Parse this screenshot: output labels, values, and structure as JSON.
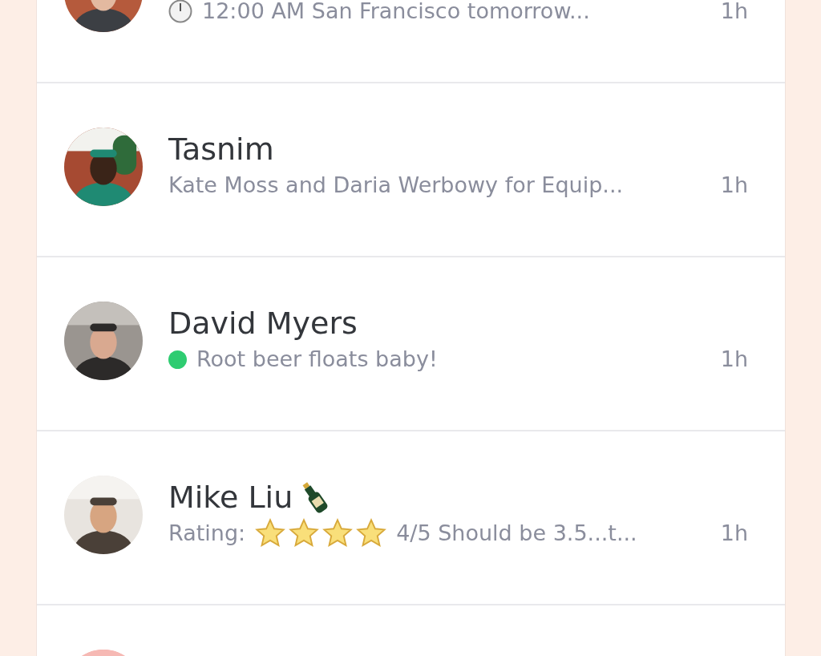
{
  "conversations": [
    {
      "message": "12:00 AM San Francisco tomorrow...",
      "time": "1h",
      "avatar": {
        "kind": "picture"
      }
    },
    {
      "name": "Tasnim",
      "message": "Kate Moss and Daria Werbowy for Equip...",
      "time": "1h",
      "avatar": {
        "kind": "picture"
      }
    },
    {
      "name": "David Myers",
      "status_dot": {
        "color": "#2ecc71"
      },
      "message": "Root beer floats baby!",
      "time": "1h",
      "avatar": {
        "kind": "picture"
      }
    },
    {
      "name": "Mike Liu",
      "message": "Rating:",
      "stars": 4,
      "message_after": "4/5 Should be 3.5...t...",
      "time": "1h",
      "avatar": {
        "kind": "picture"
      }
    },
    {
      "avatar": {
        "kind": "picture"
      }
    }
  ]
}
